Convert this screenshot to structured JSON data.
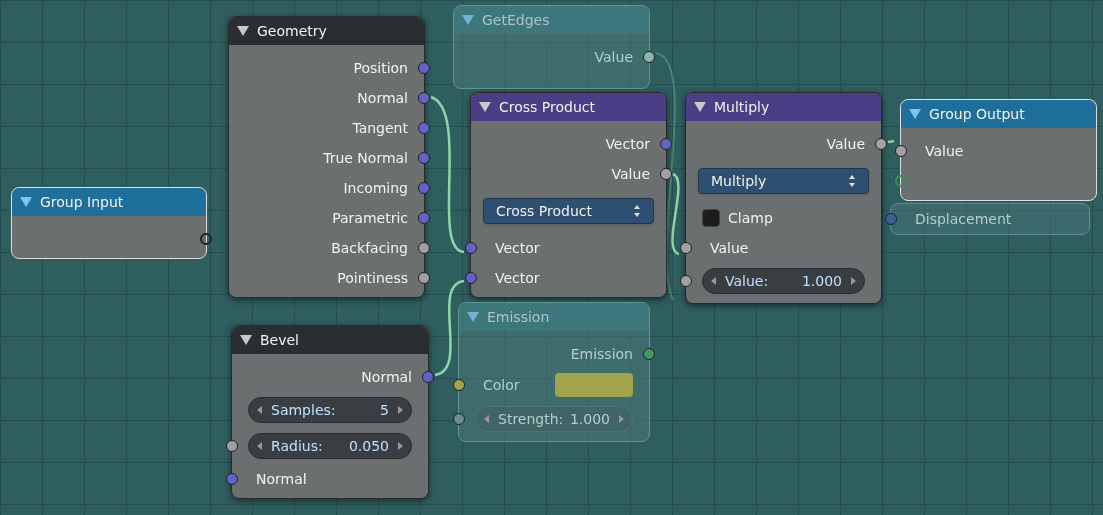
{
  "nodes": [
    {
      "kind": "frame",
      "faded": true,
      "title": "GetEdges",
      "rows": [
        {
          "kind": "output",
          "label": "Value",
          "color": "#8fb3ad"
        }
      ]
    },
    {
      "kind": "input",
      "faded": false,
      "title": "Geometry",
      "rows": [
        {
          "kind": "output",
          "label": "Position",
          "color": "#6363c7"
        },
        {
          "kind": "output",
          "label": "Normal",
          "color": "#6363c7"
        },
        {
          "kind": "output",
          "label": "Tangent",
          "color": "#6363c7"
        },
        {
          "kind": "output",
          "label": "True Normal",
          "color": "#6363c7"
        },
        {
          "kind": "output",
          "label": "Incoming",
          "color": "#6363c7"
        },
        {
          "kind": "output",
          "label": "Parametric",
          "color": "#6363c7"
        },
        {
          "kind": "output",
          "label": "Backfacing",
          "color": "#a1a1a1"
        },
        {
          "kind": "output",
          "label": "Pointiness",
          "color": "#a1a1a1"
        }
      ]
    },
    {
      "kind": "converter",
      "faded": false,
      "title": "Cross Product",
      "rows": [
        {
          "kind": "output",
          "label": "Vector",
          "color": "#6363c7"
        },
        {
          "kind": "output",
          "label": "Value",
          "color": "#a1a1a1"
        },
        {
          "kind": "menu",
          "label": "Cross Product"
        },
        {
          "kind": "input",
          "label": "Vector",
          "color": "#6363c7"
        },
        {
          "kind": "input",
          "label": "Vector",
          "color": "#6363c7"
        }
      ]
    },
    {
      "kind": "converter",
      "faded": false,
      "title": "Multiply",
      "rows": [
        {
          "kind": "output",
          "label": "Value",
          "color": "#a1a1a1"
        },
        {
          "kind": "menu",
          "label": "Multiply"
        },
        {
          "kind": "checkbox",
          "label": "Clamp",
          "checked": false
        },
        {
          "kind": "input",
          "label": "Value",
          "color": "#a1a1a1"
        },
        {
          "kind": "number",
          "label": "Value:",
          "value": "1.000",
          "color": "#a1a1a1"
        }
      ]
    },
    {
      "kind": "group",
      "faded": false,
      "title": "Group Output",
      "rows": [
        {
          "kind": "input",
          "label": "Value",
          "color": "#a1a1a1"
        },
        {
          "kind": "input",
          "hollow": true,
          "color": "#3f8a5a"
        }
      ]
    },
    {
      "kind": "group",
      "faded": false,
      "title": "Group Input",
      "rows": [
        {
          "kind": "output",
          "hollow": true,
          "color": "#222222"
        }
      ]
    },
    {
      "kind": "output",
      "faded": true,
      "rows": [
        {
          "kind": "input",
          "label": "Displacement",
          "color": "#3d5f96"
        }
      ]
    },
    {
      "kind": "shader",
      "faded": true,
      "title": "Emission",
      "rows": [
        {
          "kind": "output",
          "label": "Emission",
          "color": "#3f9a63"
        },
        {
          "kind": "color",
          "label": "Color",
          "color": "#a3a34e"
        },
        {
          "kind": "number",
          "label": "Strength:",
          "value": "1.000",
          "color": "#6c8c8c"
        }
      ]
    },
    {
      "kind": "input",
      "faded": false,
      "title": "Bevel",
      "rows": [
        {
          "kind": "output",
          "label": "Normal",
          "color": "#6363c7"
        },
        {
          "kind": "number",
          "label": "Samples:",
          "value": "5"
        },
        {
          "kind": "number",
          "label": "Radius:",
          "value": "0.050",
          "color": "#a1a1a1"
        },
        {
          "kind": "input",
          "label": "Normal",
          "color": "#6363c7"
        }
      ]
    }
  ]
}
